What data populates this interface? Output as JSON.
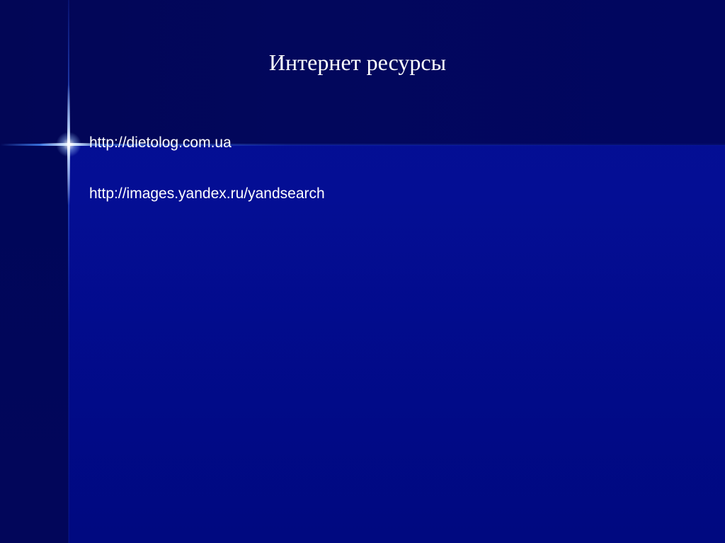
{
  "slide": {
    "title": "Интернет ресурсы",
    "links": [
      "http://dietolog.com.ua",
      "http://images.yandex.ru/yandsearch"
    ]
  },
  "theme": {
    "background": "#020656",
    "accent_line": "#4680ff",
    "text_color": "#ffffff"
  }
}
